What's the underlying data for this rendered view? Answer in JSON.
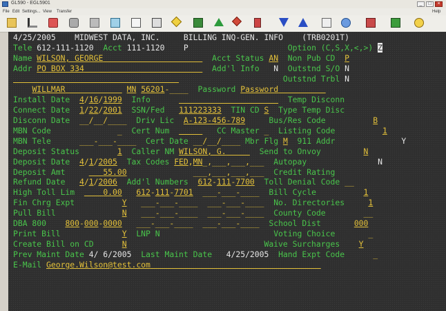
{
  "window": {
    "title": "GL590 - EGL5901",
    "min_label": "_",
    "max_label": "□",
    "close_label": "×"
  },
  "menu": {
    "items": [
      "File",
      "Edit",
      "Settings...",
      "View",
      "Transfer"
    ],
    "help": "Help"
  },
  "toolbar": {
    "icons": [
      "save-icon",
      "cut-icon",
      "copy-icon",
      "print-icon",
      "send-icon",
      "receive-icon",
      "document-icon",
      "page-icon",
      "macro-icon",
      "play-icon",
      "green-arrow-icon",
      "red-arrow-icon",
      "keyboard-icon",
      "down-arrow-icon",
      "up-arrow-icon",
      "properties-icon",
      "link-icon",
      "record-icon",
      "pen-icon",
      "help-icon"
    ]
  },
  "screen": {
    "line1": {
      "date": "4/25/2005",
      "company": "MIDWEST DATA, INC.",
      "title": "BILLING INQ-GEN. INFO",
      "code": "(TRB0201T)"
    },
    "line2": {
      "tele_label": "Tele",
      "tele": "612-111-1120",
      "acct_label": "Acct",
      "acct": "111-1120",
      "p": "P",
      "option_label": "Option (C,S,X,<,>)",
      "option_value": "Z"
    },
    "line3": {
      "name_label": "Name",
      "name": "WILSON, GEORGE",
      "acct_status_label": "Acct Status",
      "acct_status": "AN",
      "nonpub_label": "Non Pub CD",
      "nonpub": "P"
    },
    "line4": {
      "addr_label": "Addr",
      "addr": "PO BOX 334",
      "addl_info_label": "Add'l Info",
      "addl_info": "N",
      "outstnd_so_label": "Outstnd S/O",
      "outstnd_so": "N"
    },
    "line5": {
      "outstnd_trbl_label": "Outstnd Trbl",
      "outstnd_trbl": "N"
    },
    "line6": {
      "city": "WILLMAR",
      "state": "MN",
      "zip": "56201",
      "zip_ext": "____",
      "password_label": "Password",
      "password": "Password"
    },
    "line7": {
      "install_label": "Install Date",
      "install_m": "4",
      "install_d": "16",
      "install_y": "1999",
      "info_label": "Info",
      "temp_disconn_label": "Temp Disconn"
    },
    "line8": {
      "connect_label": "Connect Date",
      "connect_m": "1",
      "connect_d": "22",
      "connect_y": "2001",
      "ssn_label": "SSN/Fed",
      "ssn": "111223333",
      "tin_label": "TIN CD",
      "tin": "S",
      "type_temp_label": "Type Temp Disc"
    },
    "line9": {
      "disconn_label": "Disconn Date",
      "disconn_value": "__/__/____",
      "drivlic_label": "Driv Lic",
      "drivlic": "A-123-456-789",
      "busres_label": "Bus/Res Code",
      "busres": "B"
    },
    "line10": {
      "mbn_code_label": "MBN Code",
      "certnum_label": "Cert Num",
      "cc_master_label": "CC Master",
      "listing_label": "Listing Code",
      "listing": "1"
    },
    "line11": {
      "mbn_tele_label": "MBN Tele",
      "certdate_label": "Cert Date",
      "certdate_value": "__/__/____",
      "mbrflg_label": "Mbr Flg",
      "mbrflg": "M",
      "addr911_label": "911 Addr",
      "addr911": "Y"
    },
    "line12": {
      "deposit_status_label": "Deposit Status",
      "deposit_status": "1",
      "caller_label": "Caller NM",
      "caller": "WILSON, G.",
      "send_onvoy_label": "Send to Onvoy",
      "send_onvoy": "N"
    },
    "line13": {
      "deposit_date_label": "Deposit Date",
      "deposit_m": "4",
      "deposit_d": "1",
      "deposit_y": "2005",
      "taxcodes_label": "Tax Codes",
      "tax1": "FED",
      "tax2": "MN",
      "autopay_label": "Autopay",
      "autopay": "N"
    },
    "line14": {
      "credit_rating_label": "Credit Rating"
    },
    "line15": {
      "deposit_amt_label": "Deposit Amt",
      "deposit_amt": "55.00"
    },
    "line16": {
      "refund_label": "Refund Date",
      "refund_m": "4",
      "refund_d": "1",
      "refund_y": "2006",
      "addl_numbers_label": "Add'l Numbers",
      "addl1_a": "612",
      "addl1_b": "111",
      "addl1_c": "7700",
      "toll_denial_label": "Toll Denial Code"
    },
    "line17": {
      "high_toll_label": "High Toll Lim",
      "high_toll": "0.00",
      "addl2_a": "612",
      "addl2_b": "111",
      "addl2_c": "7701",
      "bill_cycle_label": "Bill Cycle",
      "bill_cycle": "1"
    },
    "line18": {
      "fin_chrg_label": "Fin Chrg Expt",
      "fin_chrg": "Y",
      "no_dir_label": "No. Directories",
      "no_dir": "1"
    },
    "line19": {
      "pull_bill_label": "Pull Bill",
      "pull_bill": "N",
      "county_label": "County Code"
    },
    "line20": {
      "dba_label": "DBA 800",
      "dba_a": "800",
      "dba_b": "000",
      "dba_c": "0000",
      "school_label": "School Dist",
      "school": "000"
    },
    "line21": {
      "print_bill_label": "Print Bill",
      "print_bill": "Y",
      "lnp_label": "LNP N",
      "voting_label": "Voting Choice"
    },
    "line22": {
      "create_bill_label": "Create Bill on CD",
      "create_bill": "N",
      "waive_label": "Waive Surcharges",
      "waive": "Y"
    },
    "line23": {
      "prev_maint_label": "Prev Maint Date",
      "prev_maint": "4/ 6/2005",
      "last_maint_label": "Last Maint Date",
      "last_maint": "4/25/2005",
      "hand_expt_label": "Hand Expt Code"
    },
    "line24": {
      "email_label": "E-Mail",
      "email": "George.Wilson@test.com"
    }
  }
}
